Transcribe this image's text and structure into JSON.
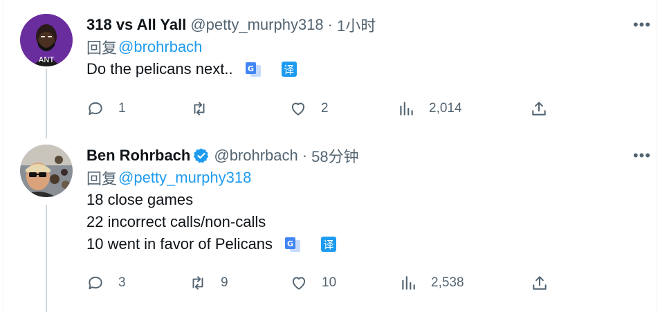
{
  "tweets": [
    {
      "display_name": "318 vs All Yall",
      "handle": "@petty_murphy318",
      "separator": "·",
      "time": "1小时",
      "reply_prefix": "回复",
      "reply_to": "@brohrbach",
      "text_lines": [
        "Do the pelicans next.."
      ],
      "translate_label": "译",
      "more_label": "•••",
      "avatar_text": "ANT",
      "verified": false,
      "stats": {
        "replies": "1",
        "retweets": "",
        "likes": "2",
        "views": "2,014"
      }
    },
    {
      "display_name": "Ben Rohrbach",
      "handle": "@brohrbach",
      "separator": "·",
      "time": "58分钟",
      "reply_prefix": "回复",
      "reply_to": "@petty_murphy318",
      "text_lines": [
        "18 close games",
        "22 incorrect calls/non-calls",
        "10 went in favor of Pelicans"
      ],
      "translate_label": "译",
      "more_label": "•••",
      "verified": true,
      "stats": {
        "replies": "3",
        "retweets": "9",
        "likes": "10",
        "views": "2,538"
      }
    }
  ],
  "colors": {
    "accent": "#1d9bf0",
    "muted": "#536471",
    "text": "#0f1419",
    "line": "#cfd9de"
  },
  "icons": [
    "reply-icon",
    "retweet-icon",
    "like-icon",
    "views-icon",
    "share-icon",
    "google-translate-icon",
    "verified-badge-icon",
    "more-icon"
  ]
}
